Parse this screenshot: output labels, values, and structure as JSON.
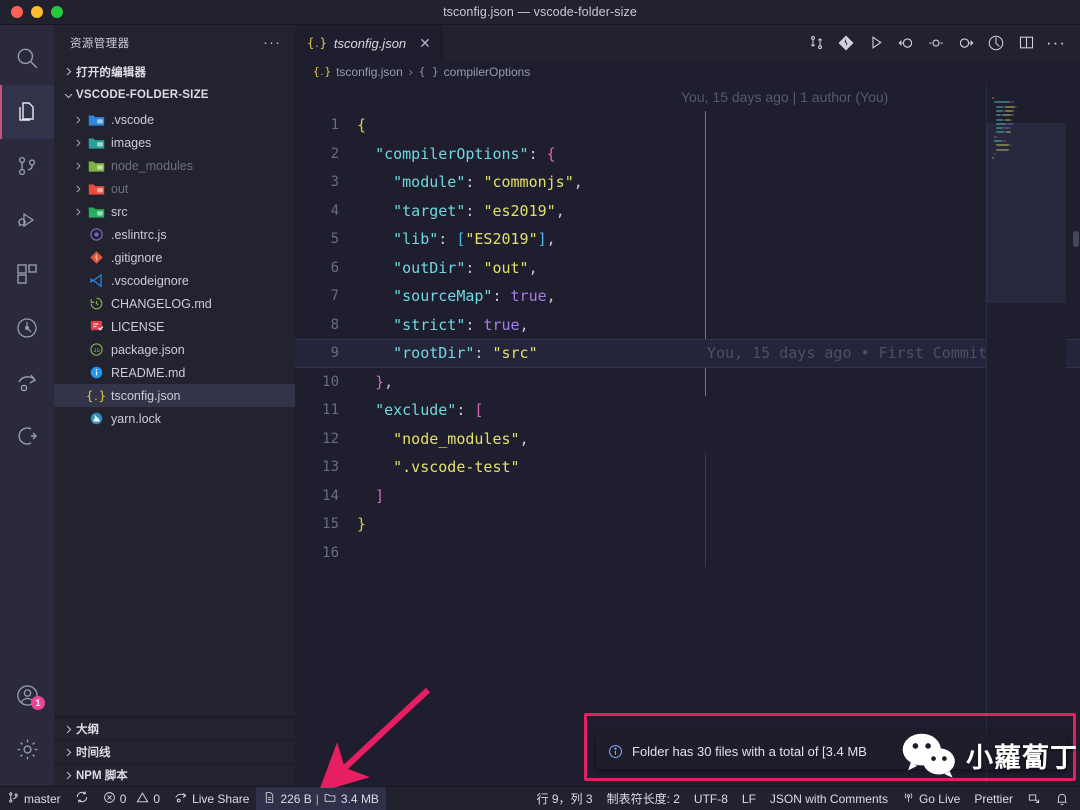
{
  "window": {
    "title": "tsconfig.json — vscode-folder-size",
    "traffic_lights": [
      "close",
      "minimize",
      "maximize"
    ]
  },
  "activity_bar": {
    "items": [
      {
        "name": "search",
        "icon": "search-icon",
        "active": false
      },
      {
        "name": "explorer",
        "icon": "files-icon",
        "active": true
      },
      {
        "name": "source-control",
        "icon": "source-control-icon",
        "active": false
      },
      {
        "name": "run-and-debug",
        "icon": "debug-icon",
        "active": false
      },
      {
        "name": "extensions",
        "icon": "extensions-icon",
        "active": false
      },
      {
        "name": "test",
        "icon": "beaker-icon",
        "active": false
      },
      {
        "name": "live-share",
        "icon": "live-share-icon",
        "active": false
      },
      {
        "name": "remote",
        "icon": "remote-explorer-icon",
        "active": false
      }
    ],
    "account": {
      "icon": "account-icon",
      "badge": "1"
    },
    "settings": {
      "icon": "gear-icon"
    },
    "badge_color": "#f0439a"
  },
  "sidebar": {
    "title": "资源管理器",
    "more_label": "···",
    "open_editors_label": "打开的编辑器",
    "folder_label": "VSCODE-FOLDER-SIZE",
    "tree": [
      {
        "label": ".vscode",
        "type": "folder",
        "icon": "folder-vscode-icon",
        "dim": false,
        "selected": false
      },
      {
        "label": "images",
        "type": "folder",
        "icon": "folder-images-icon",
        "dim": false,
        "selected": false
      },
      {
        "label": "node_modules",
        "type": "folder",
        "icon": "folder-node-icon",
        "dim": true,
        "selected": false
      },
      {
        "label": "out",
        "type": "folder",
        "icon": "folder-out-icon",
        "dim": true,
        "selected": false
      },
      {
        "label": "src",
        "type": "folder",
        "icon": "folder-src-icon",
        "dim": false,
        "selected": false
      },
      {
        "label": ".eslintrc.js",
        "type": "file",
        "icon": "eslint-icon",
        "dim": false,
        "selected": false
      },
      {
        "label": ".gitignore",
        "type": "file",
        "icon": "git-icon",
        "dim": false,
        "selected": false
      },
      {
        "label": ".vscodeignore",
        "type": "file",
        "icon": "vscode-icon",
        "dim": false,
        "selected": false
      },
      {
        "label": "CHANGELOG.md",
        "type": "file",
        "icon": "changelog-icon",
        "dim": false,
        "selected": false
      },
      {
        "label": "LICENSE",
        "type": "file",
        "icon": "license-icon",
        "dim": false,
        "selected": false
      },
      {
        "label": "package.json",
        "type": "file",
        "icon": "npm-icon",
        "dim": false,
        "selected": false
      },
      {
        "label": "README.md",
        "type": "file",
        "icon": "readme-icon",
        "dim": false,
        "selected": false
      },
      {
        "label": "tsconfig.json",
        "type": "file",
        "icon": "tsconfig-icon",
        "dim": false,
        "selected": true
      },
      {
        "label": "yarn.lock",
        "type": "file",
        "icon": "yarn-icon",
        "dim": false,
        "selected": false
      }
    ],
    "panels": [
      {
        "label": "大纲"
      },
      {
        "label": "时间线"
      },
      {
        "label": "NPM 脚本"
      }
    ]
  },
  "editor": {
    "tab": {
      "label": "tsconfig.json",
      "icon": "json-icon",
      "close_icon": "close-icon",
      "dirty": false
    },
    "actions": [
      {
        "name": "compare-changes",
        "icon": "compare-changes-icon"
      },
      {
        "name": "source-control-diamond",
        "icon": "git-diamond-icon"
      },
      {
        "name": "run",
        "icon": "play-icon"
      },
      {
        "name": "go-back",
        "icon": "arrow-circle-left-icon"
      },
      {
        "name": "marker",
        "icon": "circle-dash-icon"
      },
      {
        "name": "go-forward",
        "icon": "arrow-circle-right-icon"
      },
      {
        "name": "toggle-blame",
        "icon": "clock-circle-icon"
      },
      {
        "name": "split-editor",
        "icon": "split-editor-icon"
      },
      {
        "name": "more-actions",
        "icon": "ellipsis-icon"
      }
    ],
    "breadcrumbs": [
      {
        "label": "tsconfig.json",
        "icon": "json-icon"
      },
      {
        "label": "compilerOptions",
        "icon": "object-braces-icon"
      }
    ],
    "breadcrumb_separator": "›",
    "blame_header": "You, 15 days ago | 1 author (You)",
    "inline_blame": {
      "line": 9,
      "text": "You, 15 days ago • First Commit"
    },
    "highlight_line": 9,
    "lines": [
      {
        "n": 1,
        "tokens": [
          {
            "t": "{",
            "c": "punc"
          }
        ]
      },
      {
        "n": 2,
        "tokens": [
          {
            "t": "  ",
            "c": "op"
          },
          {
            "t": "\"compilerOptions\"",
            "c": "key"
          },
          {
            "t": ": ",
            "c": "op"
          },
          {
            "t": "{",
            "c": "brace2"
          }
        ]
      },
      {
        "n": 3,
        "tokens": [
          {
            "t": "    ",
            "c": "op"
          },
          {
            "t": "\"module\"",
            "c": "key"
          },
          {
            "t": ": ",
            "c": "op"
          },
          {
            "t": "\"commonjs\"",
            "c": "str"
          },
          {
            "t": ",",
            "c": "op"
          }
        ]
      },
      {
        "n": 4,
        "tokens": [
          {
            "t": "    ",
            "c": "op"
          },
          {
            "t": "\"target\"",
            "c": "key"
          },
          {
            "t": ": ",
            "c": "op"
          },
          {
            "t": "\"es2019\"",
            "c": "str"
          },
          {
            "t": ",",
            "c": "op"
          }
        ]
      },
      {
        "n": 5,
        "tokens": [
          {
            "t": "    ",
            "c": "op"
          },
          {
            "t": "\"lib\"",
            "c": "key"
          },
          {
            "t": ": ",
            "c": "op"
          },
          {
            "t": "[",
            "c": "brace3"
          },
          {
            "t": "\"ES2019\"",
            "c": "str"
          },
          {
            "t": "]",
            "c": "brace3"
          },
          {
            "t": ",",
            "c": "op"
          }
        ]
      },
      {
        "n": 6,
        "tokens": [
          {
            "t": "    ",
            "c": "op"
          },
          {
            "t": "\"outDir\"",
            "c": "key"
          },
          {
            "t": ": ",
            "c": "op"
          },
          {
            "t": "\"out\"",
            "c": "str"
          },
          {
            "t": ",",
            "c": "op"
          }
        ]
      },
      {
        "n": 7,
        "tokens": [
          {
            "t": "    ",
            "c": "op"
          },
          {
            "t": "\"sourceMap\"",
            "c": "key"
          },
          {
            "t": ": ",
            "c": "op"
          },
          {
            "t": "true",
            "c": "bool"
          },
          {
            "t": ",",
            "c": "op"
          }
        ]
      },
      {
        "n": 8,
        "tokens": [
          {
            "t": "    ",
            "c": "op"
          },
          {
            "t": "\"strict\"",
            "c": "key"
          },
          {
            "t": ": ",
            "c": "op"
          },
          {
            "t": "true",
            "c": "bool"
          },
          {
            "t": ",",
            "c": "op"
          }
        ]
      },
      {
        "n": 9,
        "tokens": [
          {
            "t": "    ",
            "c": "op"
          },
          {
            "t": "\"rootDir\"",
            "c": "key"
          },
          {
            "t": ": ",
            "c": "op"
          },
          {
            "t": "\"src\"",
            "c": "str"
          }
        ]
      },
      {
        "n": 10,
        "tokens": [
          {
            "t": "  ",
            "c": "op"
          },
          {
            "t": "}",
            "c": "brace2"
          },
          {
            "t": ",",
            "c": "op"
          }
        ]
      },
      {
        "n": 11,
        "tokens": [
          {
            "t": "  ",
            "c": "op"
          },
          {
            "t": "\"exclude\"",
            "c": "key"
          },
          {
            "t": ": ",
            "c": "op"
          },
          {
            "t": "[",
            "c": "brace2"
          }
        ]
      },
      {
        "n": 12,
        "tokens": [
          {
            "t": "    ",
            "c": "op"
          },
          {
            "t": "\"node_modules\"",
            "c": "str"
          },
          {
            "t": ",",
            "c": "op"
          }
        ]
      },
      {
        "n": 13,
        "tokens": [
          {
            "t": "    ",
            "c": "op"
          },
          {
            "t": "\".vscode-test\"",
            "c": "str"
          }
        ]
      },
      {
        "n": 14,
        "tokens": [
          {
            "t": "  ",
            "c": "op"
          },
          {
            "t": "]",
            "c": "brace2"
          }
        ]
      },
      {
        "n": 15,
        "tokens": [
          {
            "t": "}",
            "c": "punc"
          }
        ]
      },
      {
        "n": 16,
        "tokens": []
      }
    ]
  },
  "status_bar": {
    "left": [
      {
        "name": "remote-branch",
        "icon": "git-branch-icon",
        "label": "master",
        "highlight": false
      },
      {
        "name": "sync-changes",
        "icon": "sync-icon",
        "label": "",
        "highlight": false
      },
      {
        "name": "problems",
        "icon": "errors-warnings-icon",
        "label": "0  0",
        "error_count": "0",
        "warning_count": "0",
        "highlight": false
      },
      {
        "name": "live-share",
        "icon": "live-share-icon",
        "label": "Live Share",
        "highlight": false
      },
      {
        "name": "folder-size",
        "icon": "file-size-icon",
        "label": "226 B | 3.4 MB",
        "file_size": "226 B",
        "folder_size": "3.4 MB",
        "highlight": true
      }
    ],
    "right": [
      {
        "name": "cursor-position",
        "label": "行 9，列 3"
      },
      {
        "name": "indentation",
        "label": "制表符长度: 2"
      },
      {
        "name": "encoding",
        "label": "UTF-8"
      },
      {
        "name": "eol",
        "label": "LF"
      },
      {
        "name": "language-mode",
        "label": "JSON with Comments"
      },
      {
        "name": "go-live",
        "icon": "broadcast-icon",
        "label": "Go Live"
      },
      {
        "name": "prettier",
        "label": "Prettier"
      },
      {
        "name": "screencast",
        "icon": "screencast-icon",
        "label": ""
      },
      {
        "name": "notifications",
        "icon": "bell-icon",
        "label": ""
      }
    ]
  },
  "notification": {
    "icon": "info-icon",
    "message": "Folder has 30 files with a total of [3.4 MB",
    "file_count": "30",
    "total_size": "3.4 MB",
    "highlight_color": "#e81e63"
  },
  "watermark": {
    "text": "小蘿蔔丁",
    "icon": "wechat-icon"
  },
  "annotation": {
    "arrow_color": "#e81e63",
    "points_to": "folder-size"
  }
}
